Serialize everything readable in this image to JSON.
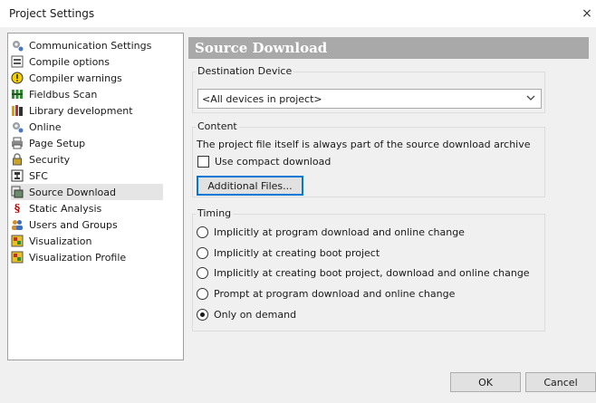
{
  "window": {
    "title": "Project Settings",
    "close_glyph": "×"
  },
  "tree": {
    "items": [
      {
        "label": "Communication Settings",
        "icon": "gear-icon"
      },
      {
        "label": "Compile options",
        "icon": "compile-icon"
      },
      {
        "label": "Compiler warnings",
        "icon": "warning-icon"
      },
      {
        "label": "Fieldbus Scan",
        "icon": "fieldbus-icon"
      },
      {
        "label": "Library development",
        "icon": "library-icon"
      },
      {
        "label": "Online",
        "icon": "online-gear-icon"
      },
      {
        "label": "Page Setup",
        "icon": "printer-icon"
      },
      {
        "label": "Security",
        "icon": "lock-icon"
      },
      {
        "label": "SFC",
        "icon": "sfc-icon"
      },
      {
        "label": "Source Download",
        "icon": "download-icon",
        "selected": true
      },
      {
        "label": "Static Analysis",
        "icon": "paragraph-icon"
      },
      {
        "label": "Users and Groups",
        "icon": "users-icon"
      },
      {
        "label": "Visualization",
        "icon": "visualization-icon"
      },
      {
        "label": "Visualization Profile",
        "icon": "visualization-profile-icon"
      }
    ]
  },
  "panel": {
    "header": "Source Download",
    "destination": {
      "title": "Destination Device",
      "selected_value": "<All devices in project>"
    },
    "content": {
      "title": "Content",
      "note": "The project file itself is always part of the source download archive",
      "compact_label": "Use compact download",
      "compact_checked": false,
      "additional_files_label": "Additional Files..."
    },
    "timing": {
      "title": "Timing",
      "options": [
        {
          "label": "Implicitly at program download and online change",
          "checked": false
        },
        {
          "label": "Implicitly at creating boot project",
          "checked": false
        },
        {
          "label": "Implicitly at creating boot project, download and online change",
          "checked": false
        },
        {
          "label": "Prompt at program download and online change",
          "checked": false
        },
        {
          "label": "Only on demand",
          "checked": true
        }
      ]
    }
  },
  "footer": {
    "ok_label": "OK",
    "cancel_label": "Cancel"
  }
}
